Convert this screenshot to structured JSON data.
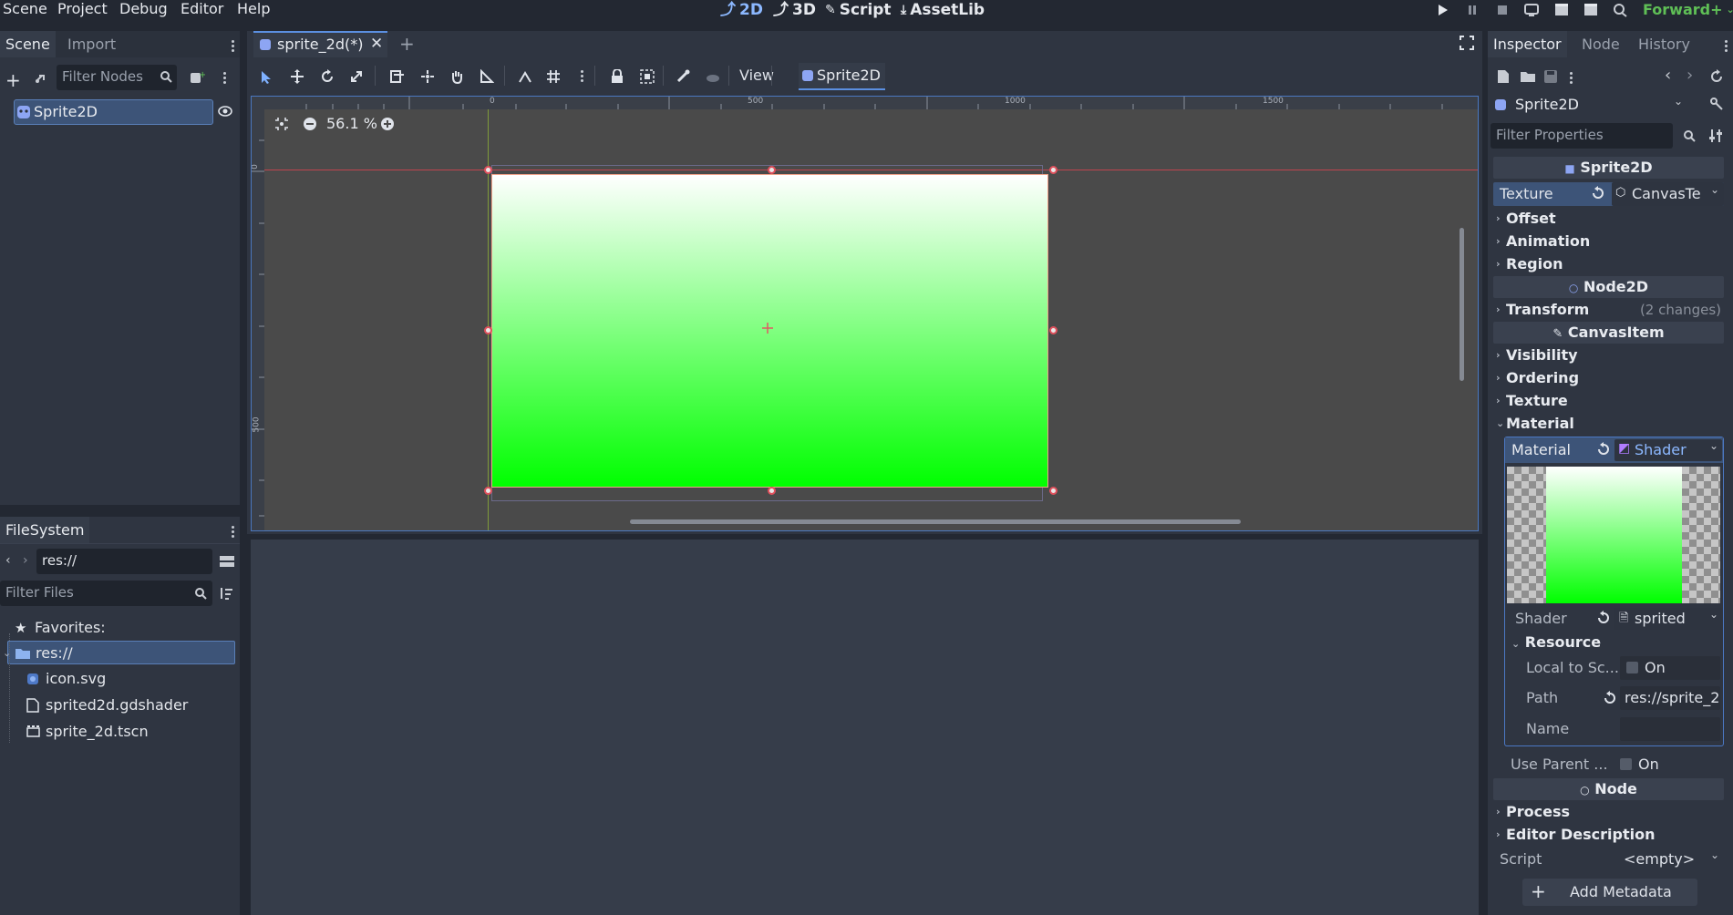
{
  "menu": [
    "Scene",
    "Project",
    "Debug",
    "Editor",
    "Help"
  ],
  "workspaces": [
    {
      "label": "2D",
      "icon": "2d-icon",
      "active": true
    },
    {
      "label": "3D",
      "icon": "3d-icon",
      "active": false
    },
    {
      "label": "Script",
      "icon": "script-icon",
      "active": false
    },
    {
      "label": "AssetLib",
      "icon": "assetlib-icon",
      "active": false
    }
  ],
  "renderer": "Forward+",
  "scene_dock": {
    "tabs": [
      "Scene",
      "Import"
    ],
    "filter_placeholder": "Filter Nodes",
    "nodes": [
      {
        "label": "Sprite2D",
        "selected": true
      }
    ]
  },
  "filesystem_dock": {
    "tab": "FileSystem",
    "path": "res://",
    "filter_placeholder": "Filter Files",
    "favorites_label": "Favorites:",
    "root": "res://",
    "files": [
      "icon.svg",
      "sprited2d.gdshader",
      "sprite_2d.tscn"
    ]
  },
  "editor_tabs": [
    {
      "label": "sprite_2d(*)",
      "active": true
    }
  ],
  "toolbar": {
    "view_label": "View",
    "node_label": "Sprite2D"
  },
  "viewport": {
    "zoom": "56.1 %",
    "ruler_h": [
      "0",
      "500",
      "1000",
      "1500"
    ],
    "ruler_v": [
      "0",
      "500"
    ],
    "gradient_top": "#ffffff",
    "gradient_bottom": "#00ff00"
  },
  "inspector": {
    "tabs": [
      "Inspector",
      "Node",
      "History"
    ],
    "object_name": "Sprite2D",
    "filter_placeholder": "Filter Properties",
    "sections": {
      "sprite2d": "Sprite2D",
      "node2d": "Node2D",
      "canvasitem": "CanvasItem",
      "node": "Node"
    },
    "texture_label": "Texture",
    "texture_value": "CanvasTe",
    "groups_sprite": [
      "Offset",
      "Animation",
      "Region"
    ],
    "transform_label": "Transform",
    "transform_changes": "(2 changes)",
    "groups_canvas": [
      "Visibility",
      "Ordering",
      "Texture"
    ],
    "material_group": "Material",
    "material_label": "Material",
    "material_value": "Shader",
    "shader_label": "Shader",
    "shader_value": "sprited",
    "resource_group": "Resource",
    "local_to_scene_label": "Local to Sc...",
    "on_label": "On",
    "path_label": "Path",
    "path_value": "res://sprite_2",
    "name_label": "Name",
    "use_parent_label": "Use Parent ...",
    "groups_node": [
      "Process",
      "Editor Description"
    ],
    "script_label": "Script",
    "script_value": "<empty>",
    "add_metadata": "Add Metadata"
  }
}
